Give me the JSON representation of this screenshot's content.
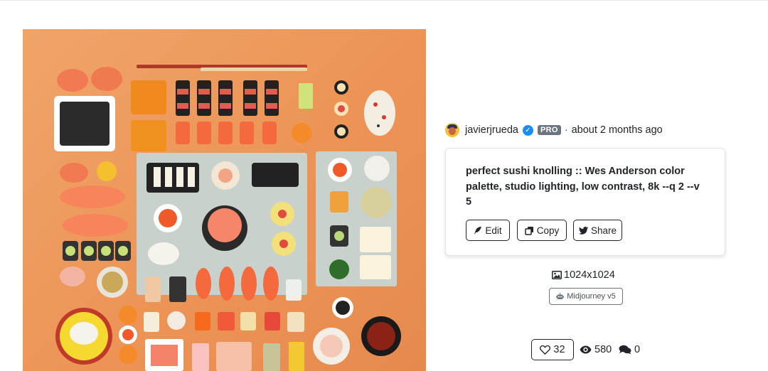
{
  "author": {
    "name": "javierjrueda",
    "badge": "PRO",
    "separator": "·",
    "time": "about 2 months ago"
  },
  "prompt": {
    "text": "perfect sushi knolling :: Wes Anderson color palette, studio lighting, low contrast, 8k --q 2 --v 5"
  },
  "actions": {
    "edit_label": "Edit",
    "copy_label": "Copy",
    "share_label": "Share"
  },
  "image_info": {
    "dimensions": "1024x1024",
    "model": "Midjourney v5"
  },
  "stats": {
    "likes": "32",
    "views": "580",
    "comments": "0"
  },
  "icons": {
    "verified": "verified-check-icon",
    "edit": "feather-icon",
    "copy": "copy-icon",
    "share": "twitter-icon",
    "dimensions": "image-icon",
    "model": "robot-icon",
    "likes": "heart-icon",
    "views": "eye-icon",
    "comments": "chat-icon"
  },
  "colors": {
    "background_art": "#ec9456",
    "verified": "#1d8cf0",
    "pro_badge": "#6c757d"
  }
}
